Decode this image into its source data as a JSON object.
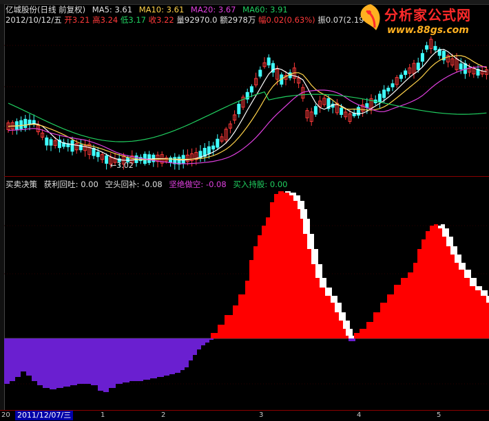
{
  "header": {
    "stock_name": "亿城股份",
    "period_info": "(日线 前复权)",
    "ma5_label": "MA5:",
    "ma5_value": "3.61",
    "ma10_label": "MA10:",
    "ma10_value": "3.61",
    "ma20_label": "MA20:",
    "ma20_value": "3.67",
    "ma60_label": "MA60:",
    "ma60_value": "3.91"
  },
  "quote": {
    "date": "2012/10/12/五",
    "open_label": "开",
    "open_value": "3.21",
    "high_label": "高",
    "high_value": "3.24",
    "low_label": "低",
    "low_value": "3.17",
    "close_label": "收",
    "close_value": "3.22",
    "volume_label": "量",
    "volume_value": "92970.0",
    "amount_label": "额",
    "amount_value": "2978万",
    "change_label": "幅",
    "change_value": "0.02(0.63%)",
    "amplitude_label": "振",
    "amplitude_value": "0.07(2.19%)"
  },
  "price_panel": {
    "low_marker": "3.02"
  },
  "indicator": {
    "name": "买卖决策",
    "profit_label": "获利回吐:",
    "profit_value": "0.00",
    "short_label": "空头回补:",
    "short_value": "-0.08",
    "never_short_label": "坚绝做空:",
    "never_short_value": "-0.08",
    "buy_hold_label": "买入持股:",
    "buy_hold_value": "0.00"
  },
  "x_axis": {
    "first_tick": "20",
    "selected_date": "2011/12/07/三",
    "ticks": [
      "1",
      "2",
      "3",
      "4",
      "5"
    ]
  },
  "watermark": {
    "title": "分析家公式网",
    "url": "www.88gs.com"
  },
  "colors": {
    "up": "#ff3a3a",
    "down": "#40ffff",
    "ma5": "#ffffff",
    "ma10": "#ffd24a",
    "ma20": "#e040e0",
    "ma60": "#20d060",
    "buy_hold": "#ff0000",
    "never_short": "#6a1fd0",
    "profit_take": "#ffffff",
    "short_cover": "#7fffd4"
  }
}
